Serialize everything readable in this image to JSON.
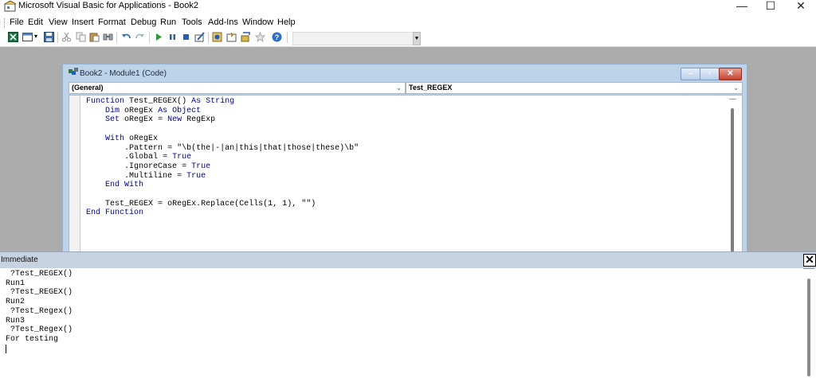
{
  "window": {
    "title": "Microsoft Visual Basic for Applications - Book2",
    "minimize_glyph": "—",
    "maximize_glyph": "☐",
    "close_glyph": "✕"
  },
  "menu": [
    "File",
    "Edit",
    "View",
    "Insert",
    "Format",
    "Debug",
    "Run",
    "Tools",
    "Add-Ins",
    "Window",
    "Help"
  ],
  "toolbar": {
    "icons": [
      "excel-icon",
      "insert-userform-icon",
      "save-icon",
      "cut-icon",
      "copy-icon",
      "paste-icon",
      "find-icon",
      "undo-icon",
      "redo-icon",
      "run-icon",
      "break-icon",
      "reset-icon",
      "design-mode-icon",
      "project-explorer-icon",
      "properties-window-icon",
      "object-browser-icon",
      "toolbox-icon",
      "help-icon"
    ],
    "status_text": ""
  },
  "code_window": {
    "title": "Book2 - Module1 (Code)",
    "object_combo": "(General)",
    "procedure_combo": "Test_REGEX",
    "lines": [
      "Function Test_REGEX() As String",
      "    Dim oRegEx As Object",
      "    Set oRegEx = New RegExp",
      "",
      "    With oRegEx",
      "        .Pattern = \"\\b(the|-|an|this|that|those|these)\\b\"",
      "        .Global = True",
      "        .IgnoreCase = True",
      "        .Multiline = True",
      "    End With",
      "",
      "    Test_REGEX = oRegEx.Replace(Cells(1, 1), \"\")",
      "End Function"
    ]
  },
  "immediate": {
    "title": "Immediate",
    "close_glyph": "✕",
    "lines": [
      " ?Test_REGEX()",
      "Run1",
      " ?Test_REGEX()",
      "Run2",
      " ?Test_Regex()",
      "Run3",
      " ?Test_Regex()",
      "For testing"
    ]
  },
  "colors": {
    "keyword": "#00008b",
    "workspace": "#ababab",
    "window_frame": "#bcd3ea"
  }
}
